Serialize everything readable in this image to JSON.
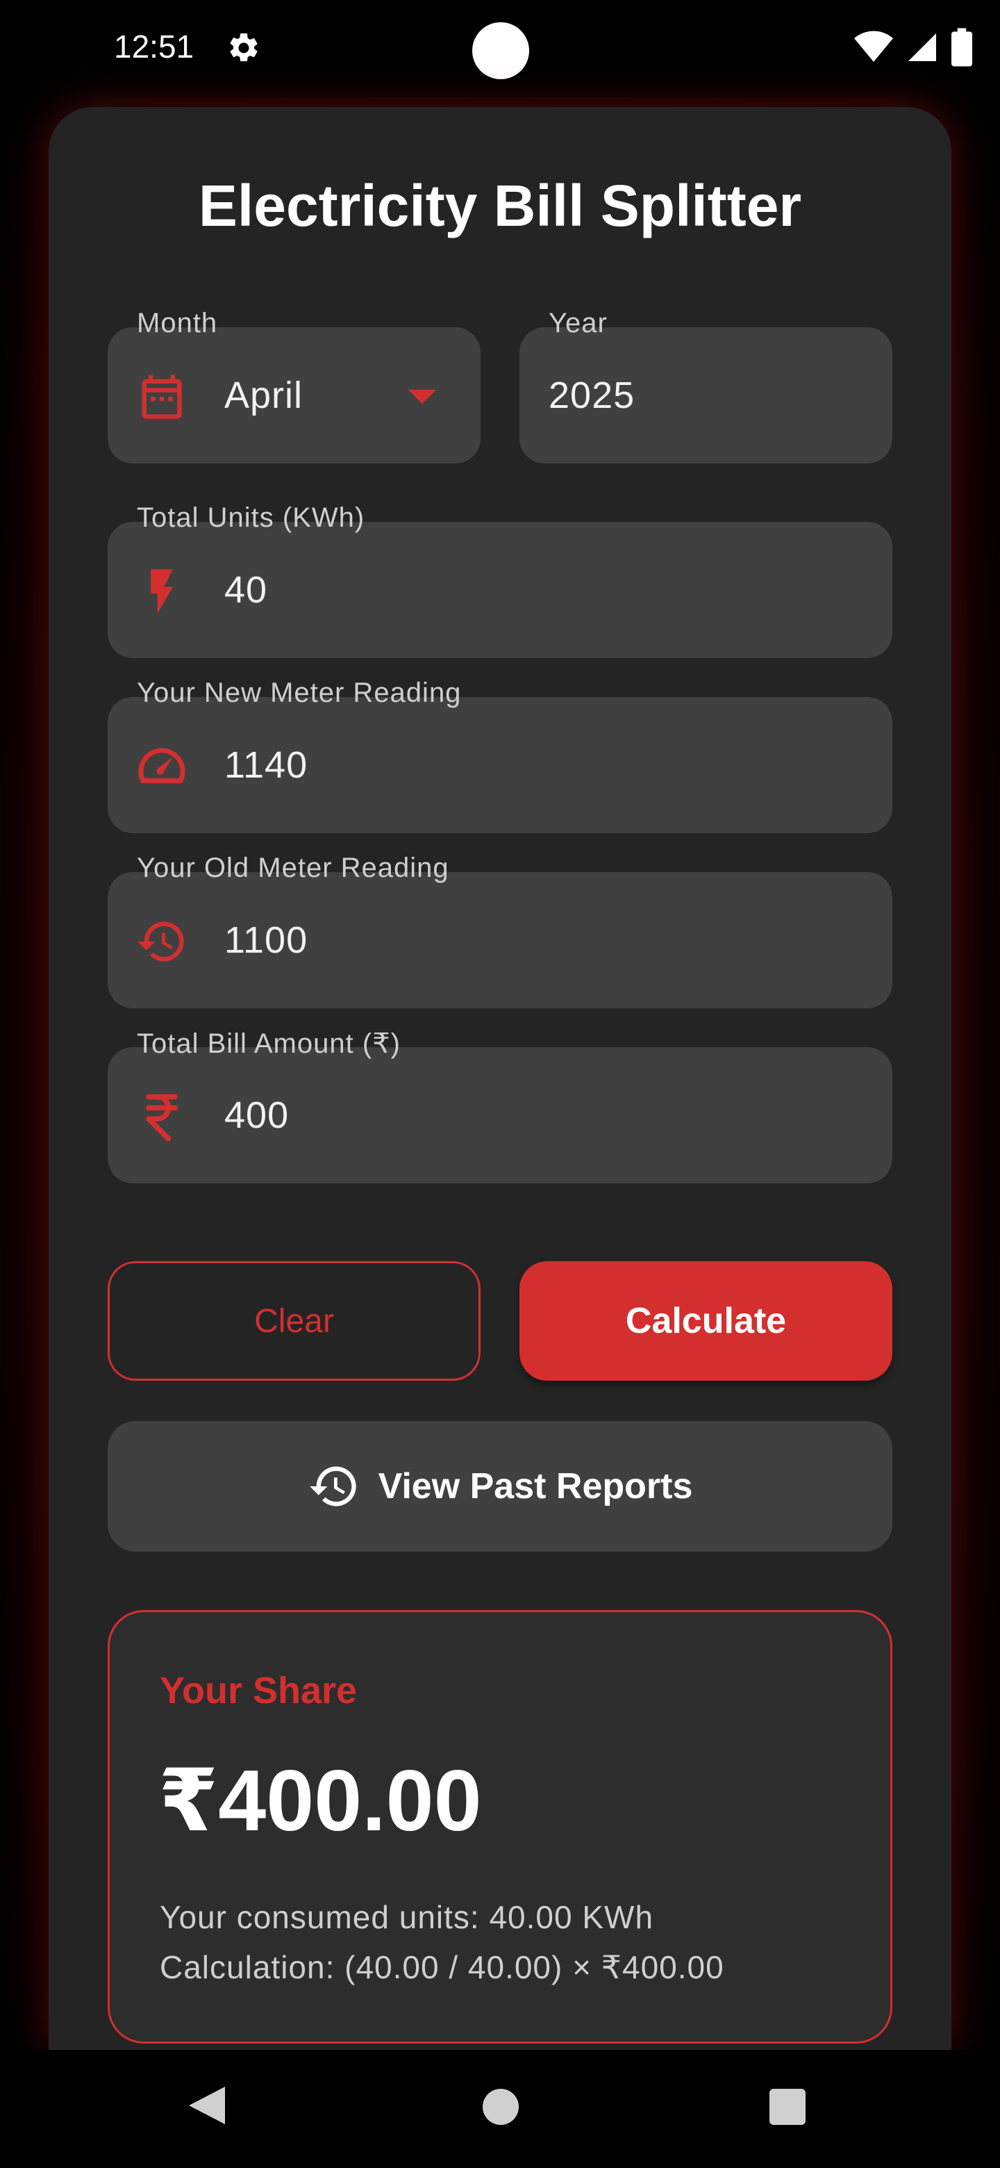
{
  "status_bar": {
    "time": "12:51"
  },
  "app": {
    "title": "Electricity Bill Splitter"
  },
  "form": {
    "month": {
      "label": "Month",
      "value": "April"
    },
    "year": {
      "label": "Year",
      "value": "2025"
    },
    "total_units": {
      "label": "Total Units (KWh)",
      "value": "40"
    },
    "new_reading": {
      "label": "Your New Meter Reading",
      "value": "1140"
    },
    "old_reading": {
      "label": "Your Old Meter Reading",
      "value": "1100"
    },
    "bill_amount": {
      "label": "Total Bill Amount (₹)",
      "value": "400"
    }
  },
  "buttons": {
    "clear": "Clear",
    "calculate": "Calculate",
    "past_reports": "View Past Reports"
  },
  "result": {
    "title": "Your Share",
    "amount": "₹400.00",
    "consumed": "Your consumed units: 40.00 KWh",
    "calculation": "Calculation: (40.00 / 40.00) × ₹400.00"
  },
  "icons": {
    "month": "calendar-icon",
    "units": "bolt-icon",
    "new_reading": "speedometer-icon",
    "old_reading": "history-icon",
    "bill": "rupee-icon",
    "past_reports": "history-icon",
    "settings": "gear-icon"
  },
  "colors": {
    "accent": "#d32f2f",
    "field_bg": "#404040",
    "card_bg": "#242424"
  }
}
